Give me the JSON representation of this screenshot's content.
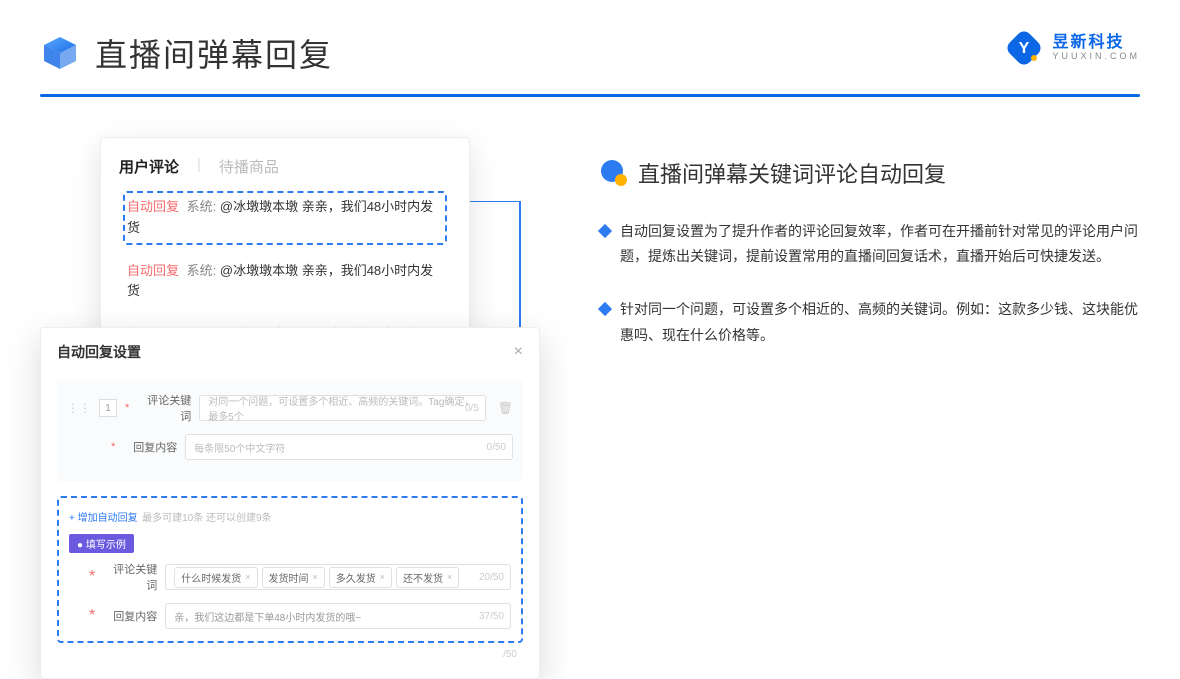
{
  "header": {
    "title": "直播间弹幕回复",
    "brand_cn": "昱新科技",
    "brand_en": "YUUXIN.COM"
  },
  "comment_card": {
    "tab_active": "用户评论",
    "tab_inactive": "待播商品",
    "rows": [
      {
        "auto": "自动回复",
        "sys": "系统:",
        "text": "@冰墩墩本墩 亲亲，我们48小时内发货"
      },
      {
        "auto": "自动回复",
        "sys": "系统:",
        "text": "@冰墩墩本墩 亲亲，我们48小时内发货"
      },
      {
        "auto": "自动回复",
        "sys": "系统:",
        "text": "@冰墩墩本墩 关注我们的店铺，每日都有热门推荐哟～"
      }
    ]
  },
  "settings": {
    "title": "自动回复设置",
    "row_num": "1",
    "keyword_label": "评论关键词",
    "keyword_placeholder": "对同一个问题，可设置多个相近、高频的关键词。Tag确定，最多5个",
    "keyword_count": "0/5",
    "content_label": "回复内容",
    "content_placeholder": "每条限50个中文字符",
    "content_count": "0/50",
    "add_link": "+ 增加自动回复",
    "add_sub": "最多可建10条 还可以创建9条",
    "example_badge": "● 填写示例",
    "example_kw_label": "评论关键词",
    "example_tags": [
      "什么时候发货",
      "发货时间",
      "多久发货",
      "还不发货"
    ],
    "example_kw_count": "20/50",
    "example_content_label": "回复内容",
    "example_content": "亲，我们这边都是下单48小时内发货的哦~",
    "example_content_count": "37/50",
    "footer_count": "/50"
  },
  "right": {
    "section_title": "直播间弹幕关键词评论自动回复",
    "bullets": [
      "自动回复设置为了提升作者的评论回复效率，作者可在开播前针对常见的评论用户问题，提炼出关键词，提前设置常用的直播间回复话术，直播开始后可快捷发送。",
      "针对同一个问题，可设置多个相近的、高频的关键词。例如：这款多少钱、这块能优惠吗、现在什么价格等。"
    ]
  }
}
